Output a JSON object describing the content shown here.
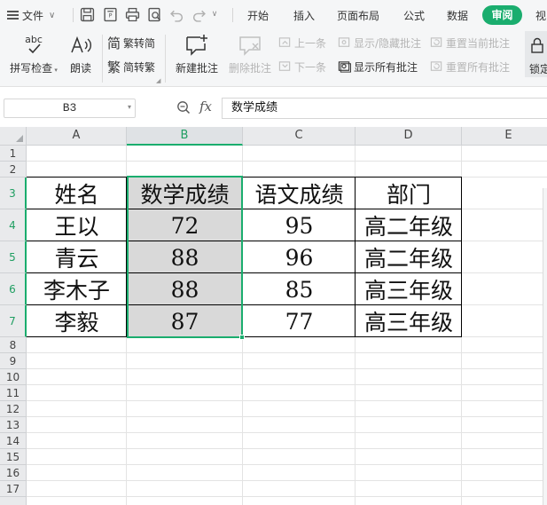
{
  "menu": {
    "file_label": "文件",
    "quick_access": [
      "save-icon",
      "export-pdf-icon",
      "print-icon",
      "print-preview-icon",
      "undo-icon",
      "redo-icon"
    ],
    "tabs": [
      "开始",
      "插入",
      "页面布局",
      "公式",
      "数据",
      "审阅",
      "视"
    ],
    "active_tab": "审阅",
    "accent_color": "#1aad6e"
  },
  "ribbon": {
    "spell_check": "拼写检查",
    "spell_icon_text": "abc",
    "read_aloud": "朗读",
    "trad_to_simp": "繁转简",
    "simp_to_trad": "简转繁",
    "trad_icon_glyph": "简",
    "simp_icon_glyph": "繁",
    "new_comment": "新建批注",
    "delete_comment": "删除批注",
    "prev_comment": "上一条",
    "next_comment": "下一条",
    "toggle_comment": "显示/隐藏批注",
    "show_all_comments": "显示所有批注",
    "reset_current": "重置当前批注",
    "reset_all": "重置所有批注",
    "lock": "锁定"
  },
  "formula_bar": {
    "name_box": "B3",
    "fx_label": "fx",
    "content": "数学成绩"
  },
  "sheet": {
    "columns": [
      "A",
      "B",
      "C",
      "D",
      "E"
    ],
    "selected_column": "B",
    "rows": [
      "1",
      "2",
      "3",
      "4",
      "5",
      "6",
      "7",
      "8",
      "9",
      "10",
      "11",
      "12",
      "13",
      "14",
      "15",
      "16",
      "17"
    ],
    "selected_rows": [
      "3",
      "4",
      "5",
      "6",
      "7"
    ],
    "table": {
      "headers": [
        "姓名",
        "数学成绩",
        "语文成绩",
        "部门"
      ],
      "rows": [
        [
          "王以",
          "72",
          "95",
          "高二年级"
        ],
        [
          "青云",
          "88",
          "96",
          "高二年级"
        ],
        [
          "李木子",
          "88",
          "85",
          "高三年级"
        ],
        [
          "李毅",
          "87",
          "77",
          "高三年级"
        ]
      ]
    },
    "selection_color": "#1aad6e",
    "selected_fill": "#d9d9d9"
  }
}
